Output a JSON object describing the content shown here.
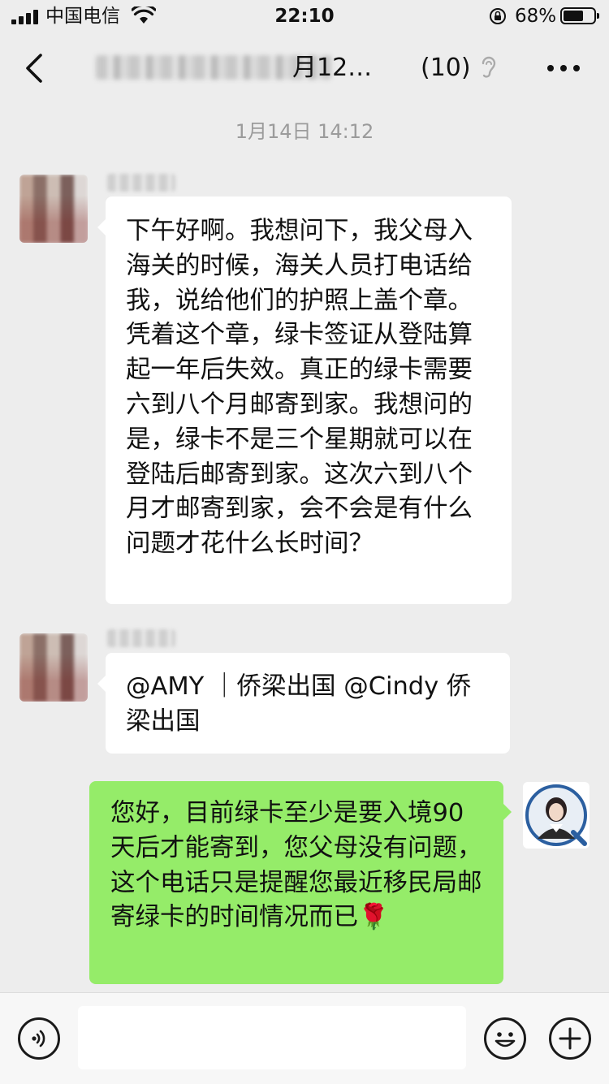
{
  "status_bar": {
    "carrier": "中国电信",
    "time": "22:10",
    "battery_percent": 68,
    "battery_label": "68%"
  },
  "nav": {
    "title_visible": "月12…",
    "member_count": "(10)",
    "icons": [
      "back-icon",
      "ear-icon",
      "more-icon"
    ]
  },
  "chat": {
    "timestamp": "1月14日 14:12",
    "messages": [
      {
        "direction": "in",
        "text": "下午好啊。我想问下，我父母入海关的时候，海关人员打电话给我，说给他们的护照上盖个章。凭着这个章，绿卡签证从登陆算起一年后失效。真正的绿卡需要六到八个月邮寄到家。我想问的是，绿卡不是三个星期就可以在登陆后邮寄到家。这次六到八个月才邮寄到家，会不会是有什么问题才花什么长时间？"
      },
      {
        "direction": "in",
        "text": "@AMY ｜侨梁出国 @Cindy 侨梁出国"
      },
      {
        "direction": "out",
        "text": "您好，目前绿卡至少是要入境90天后才能寄到，您父母没有问题，这个电话只是提醒您最近移民局邮寄绿卡的时间情况而已🌹"
      }
    ]
  },
  "input_bar": {
    "input_value": "",
    "icons": [
      "voice-icon",
      "emoji-icon",
      "plus-icon"
    ]
  },
  "colors": {
    "background": "#ededed",
    "incoming_bubble": "#ffffff",
    "outgoing_bubble": "#95ec69",
    "timestamp": "#9b9b9b"
  }
}
